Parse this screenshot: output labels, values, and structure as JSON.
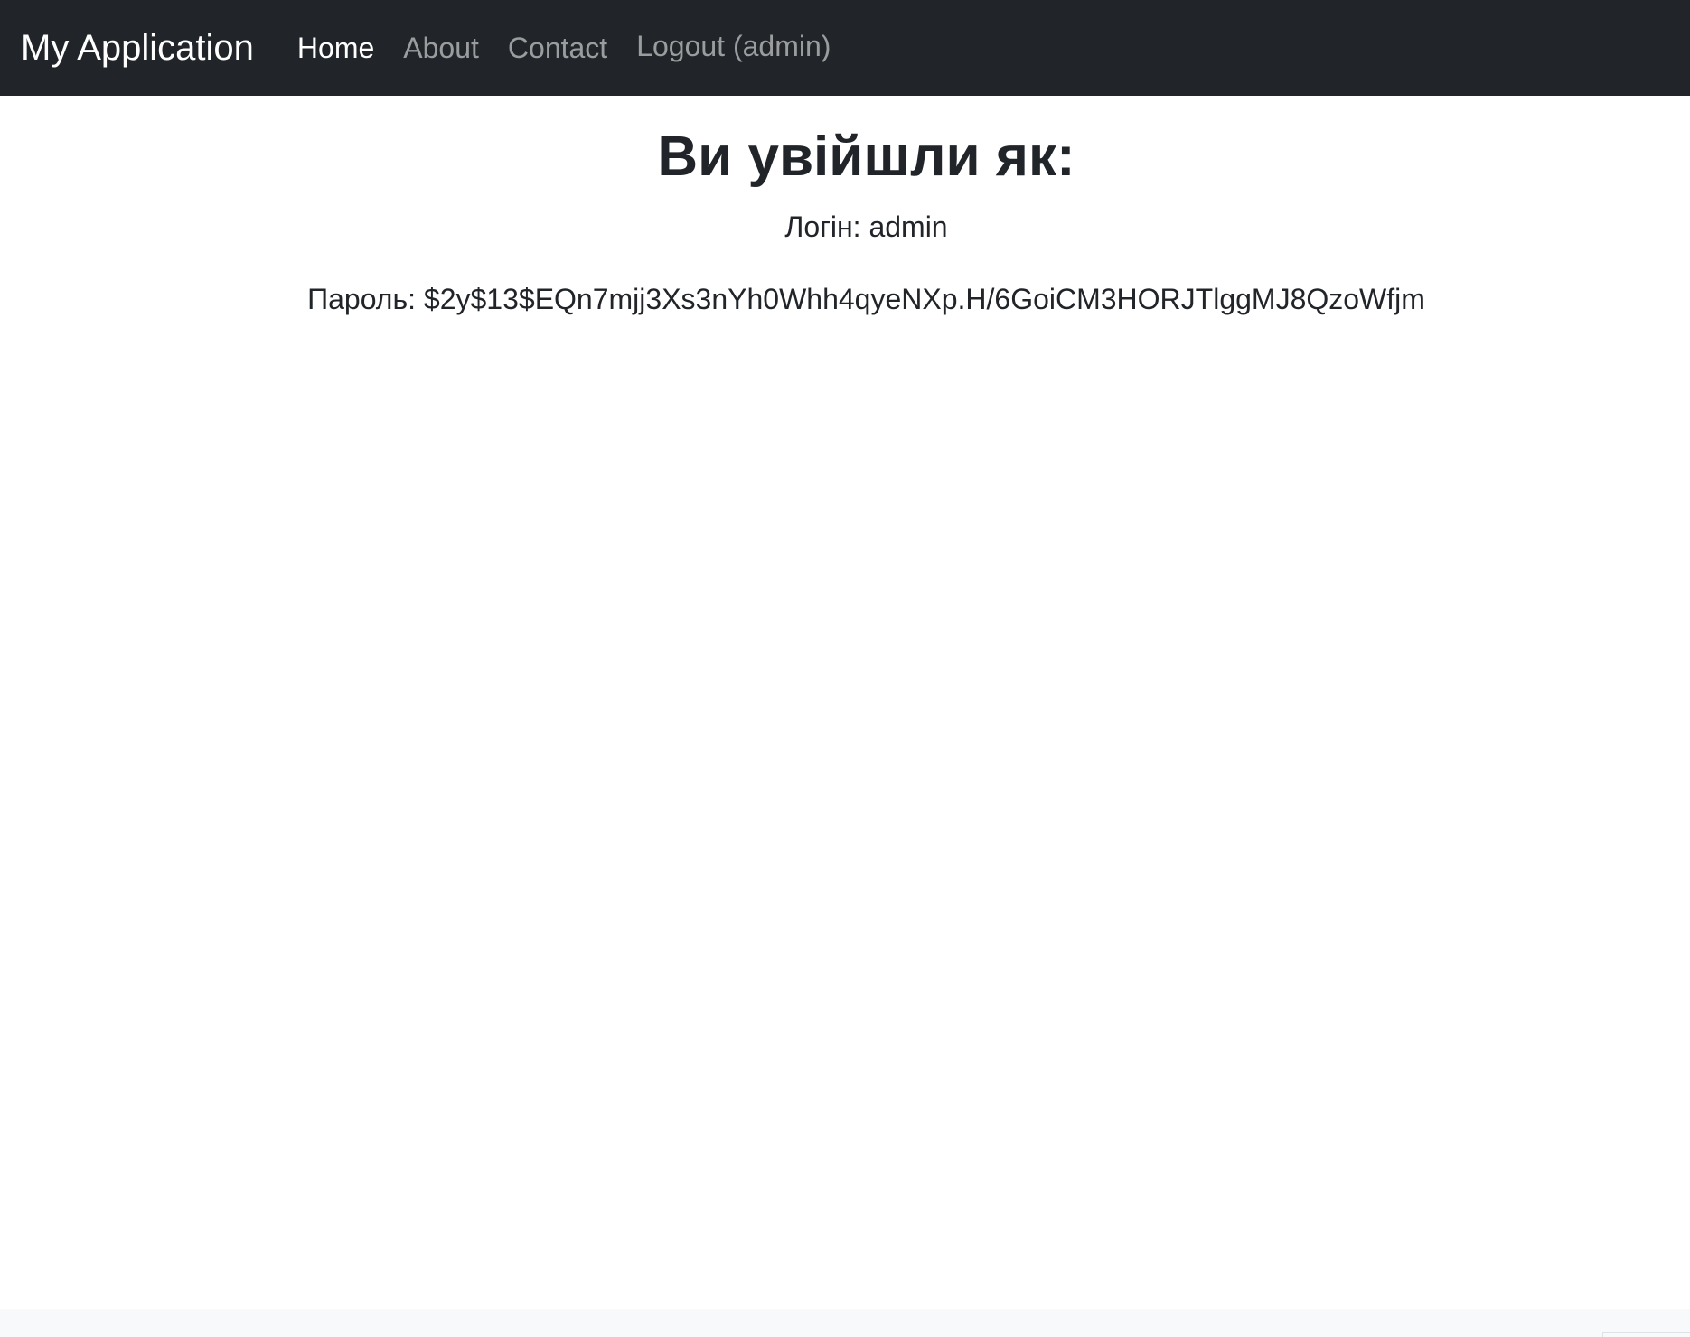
{
  "navbar": {
    "brand": "My Application",
    "items": [
      {
        "label": "Home",
        "active": true
      },
      {
        "label": "About",
        "active": false
      },
      {
        "label": "Contact",
        "active": false
      }
    ],
    "logout_label": "Logout (admin)"
  },
  "main": {
    "title": "Ви увійшли як:",
    "login_label": "Логін:",
    "login_value": "admin",
    "password_label": "Пароль:",
    "password_value": "$2y$13$EQn7mjj3Xs3nYh0Whh4qyeNXp.H/6GoiCM3HORJTlggMJ8QzoWfjm"
  },
  "colors": {
    "navbar_bg": "#212529",
    "footer_bg": "#f8f9fa",
    "text": "#212529"
  }
}
